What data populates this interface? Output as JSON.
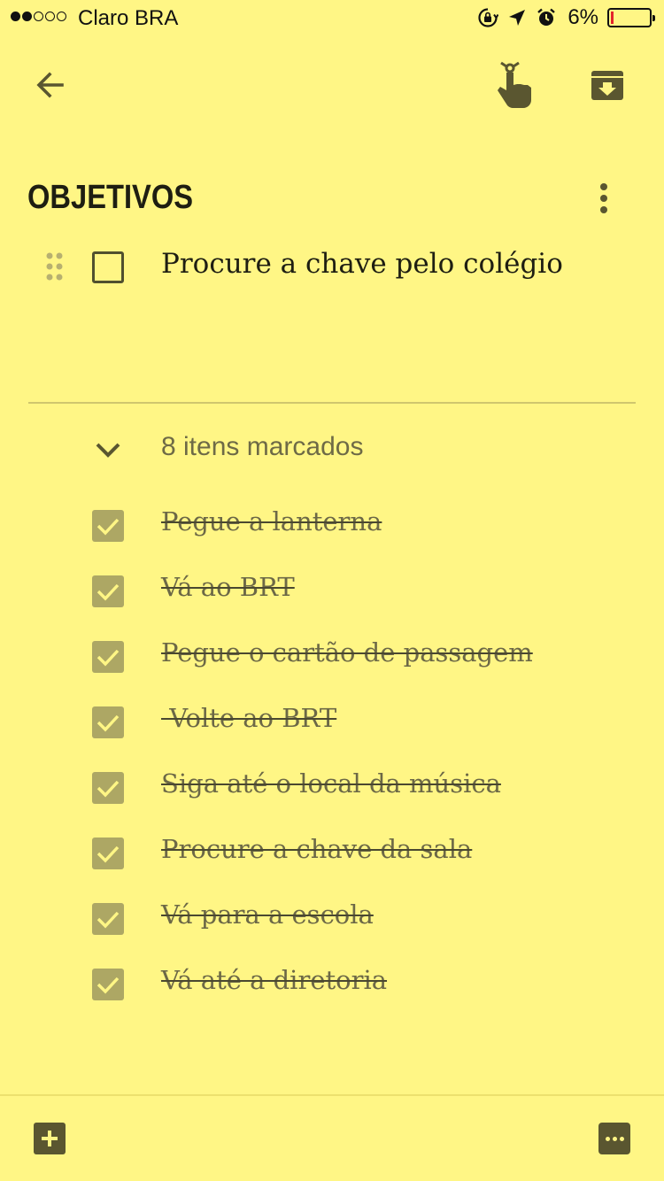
{
  "status_bar": {
    "carrier": "Claro BRA",
    "battery_percent": "6%",
    "signal_bars": 2,
    "signal_total": 5
  },
  "toolbar": {
    "back_icon": "arrow-left-icon",
    "reminder_icon": "finger-reminder-icon",
    "archive_icon": "archive-icon"
  },
  "note": {
    "title": "OBJETIVOS",
    "unchecked_items": [
      {
        "text": "Procure a chave pelo colégio"
      }
    ],
    "checked_header": "8 itens marcados",
    "checked_items": [
      {
        "text": "Pegue a lanterna"
      },
      {
        "text": "Vá ao BRT"
      },
      {
        "text": "Pegue o cartão de passagem"
      },
      {
        "text": " Volte ao BRT"
      },
      {
        "text": "Siga até o local da música"
      },
      {
        "text": "Procure a chave da sala"
      },
      {
        "text": "Vá para a escola"
      },
      {
        "text": "Vá até a diretoria"
      }
    ]
  },
  "bottom_bar": {
    "add_icon": "plus-box-icon",
    "more_icon": "more-horizontal-icon"
  },
  "colors": {
    "note_background": "#FFF685",
    "checkbox_checked": "#ADA764",
    "icon": "#5a5630"
  }
}
